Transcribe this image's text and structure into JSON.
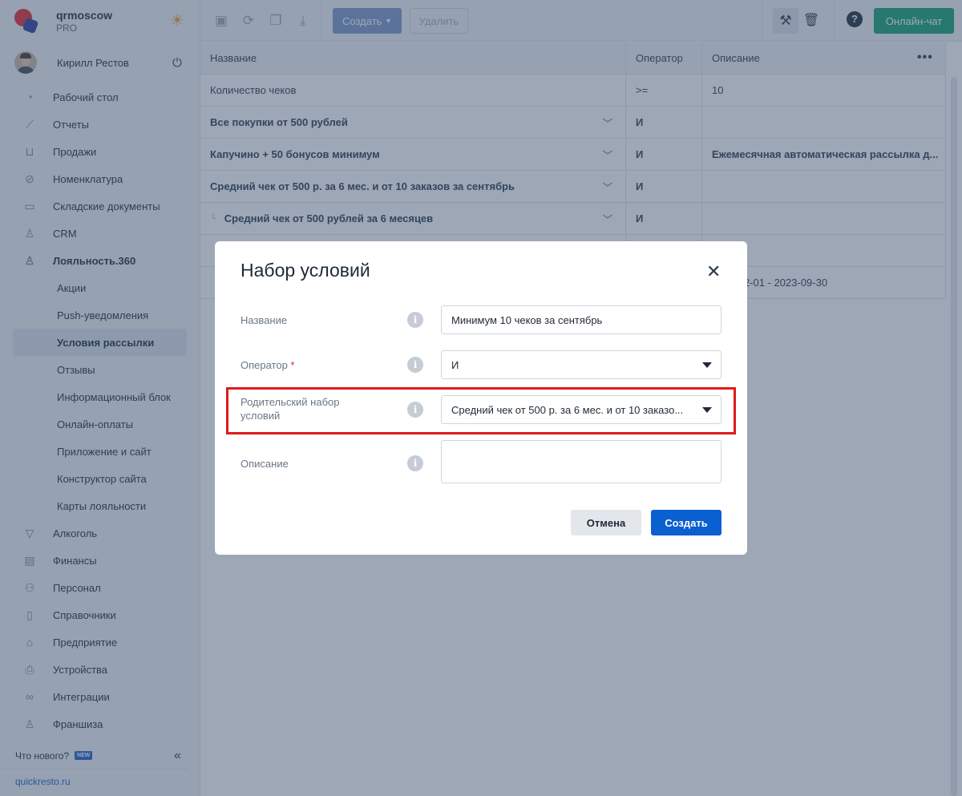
{
  "brand": {
    "name": "qrmoscow",
    "plan": "PRO"
  },
  "user": {
    "name": "Кирилл Рестов"
  },
  "nav": {
    "items": [
      {
        "label": "Рабочий стол",
        "icon": "gauge-icon"
      },
      {
        "label": "Отчеты",
        "icon": "chart-icon"
      },
      {
        "label": "Продажи",
        "icon": "basket-icon"
      },
      {
        "label": "Номенклатура",
        "icon": "tag-icon"
      },
      {
        "label": "Складские документы",
        "icon": "box-icon"
      },
      {
        "label": "CRM",
        "icon": "crm-icon"
      },
      {
        "label": "Лояльность.360",
        "icon": "loyalty-icon"
      }
    ],
    "subitems": [
      {
        "label": "Акции"
      },
      {
        "label": "Push-уведомления"
      },
      {
        "label": "Условия рассылки"
      },
      {
        "label": "Отзывы"
      },
      {
        "label": "Информационный блок"
      },
      {
        "label": "Онлайн-оплаты"
      },
      {
        "label": "Приложение и сайт"
      },
      {
        "label": "Конструктор сайта"
      },
      {
        "label": "Карты лояльности"
      }
    ],
    "items_after": [
      {
        "label": "Алкоголь",
        "icon": "glass-icon"
      },
      {
        "label": "Финансы",
        "icon": "wallet-icon"
      },
      {
        "label": "Персонал",
        "icon": "people-icon"
      },
      {
        "label": "Справочники",
        "icon": "book-icon"
      },
      {
        "label": "Предприятие",
        "icon": "store-icon"
      },
      {
        "label": "Устройства",
        "icon": "printer-icon"
      },
      {
        "label": "Интеграции",
        "icon": "infinity-icon"
      },
      {
        "label": "Франшиза",
        "icon": "franchise-icon"
      }
    ]
  },
  "footer": {
    "whats_new": "Что нового?",
    "badge": "NEW",
    "site": "quickresto.ru"
  },
  "toolbar": {
    "create_label": "Создать",
    "delete_label": "Удалить",
    "chat_label": "Онлайн-чат"
  },
  "table": {
    "headers": {
      "name": "Название",
      "operator": "Оператор",
      "description": "Описание"
    },
    "rows": [
      {
        "name": "Количество чеков",
        "operator": ">=",
        "description": "10"
      },
      {
        "name": "Все покупки от 500 рублей",
        "operator": "И",
        "description": ""
      },
      {
        "name": "Капучино + 50 бонусов минимум",
        "operator": "И",
        "description": "Ежемесячная автоматическая рассылка д..."
      },
      {
        "name": "Средний чек от 500 р. за 6 мес. и от 10 заказов за сентябрь",
        "operator": "И",
        "description": ""
      },
      {
        "name": "Средний чек от 500 рублей за 6 месяцев",
        "operator": "И",
        "description": ""
      },
      {
        "name": "",
        "operator": "",
        "description": ""
      },
      {
        "name": "",
        "operator": "",
        "description": "2-01 - 2023-09-30"
      }
    ]
  },
  "modal": {
    "title": "Набор условий",
    "fields": {
      "name_label": "Название",
      "name_value": "Минимум 10 чеков за сентябрь",
      "operator_label": "Оператор",
      "operator_required": "*",
      "operator_value": "И",
      "parent_label": "Родительский набор условий",
      "parent_value": "Средний чек от 500 р. за 6 мес. и от 10 заказо...",
      "description_label": "Описание",
      "description_value": ""
    },
    "cancel_label": "Отмена",
    "submit_label": "Создать"
  },
  "colors": {
    "accent": "#0a5fd1",
    "chat": "#12a070",
    "highlight": "#e01b1b"
  }
}
